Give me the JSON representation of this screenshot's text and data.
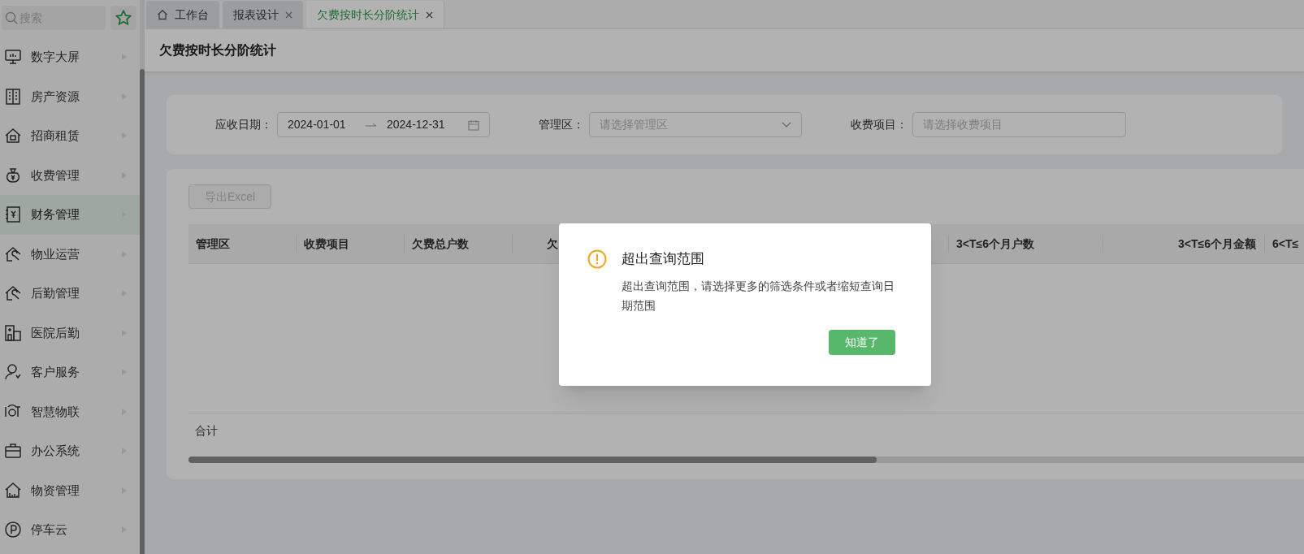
{
  "sidebar": {
    "search": {
      "placeholder": "搜索"
    },
    "items": [
      {
        "label": "数字大屏",
        "selected": false
      },
      {
        "label": "房产资源",
        "selected": false
      },
      {
        "label": "招商租赁",
        "selected": false
      },
      {
        "label": "收费管理",
        "selected": false
      },
      {
        "label": "财务管理",
        "selected": true
      },
      {
        "label": "物业运营",
        "selected": false
      },
      {
        "label": "后勤管理",
        "selected": false
      },
      {
        "label": "医院后勤",
        "selected": false
      },
      {
        "label": "客户服务",
        "selected": false
      },
      {
        "label": "智慧物联",
        "selected": false
      },
      {
        "label": "办公系统",
        "selected": false
      },
      {
        "label": "物资管理",
        "selected": false
      },
      {
        "label": "停车云",
        "selected": false
      }
    ]
  },
  "tabs": [
    {
      "label": "工作台",
      "selected": false,
      "closable": false
    },
    {
      "label": "报表设计",
      "selected": false,
      "closable": true
    },
    {
      "label": "欠费按时长分阶统计",
      "selected": true,
      "closable": true
    }
  ],
  "page_title": "欠费按时长分阶统计",
  "filters": [
    {
      "kind": "date_range",
      "label": "应收日期：",
      "start": "2024-01-01",
      "end": "2024-12-31"
    },
    {
      "kind": "select",
      "label": "管理区：",
      "placeholder": "请选择管理区"
    },
    {
      "kind": "input",
      "label": "收费项目：",
      "placeholder": "请选择收费项目"
    }
  ],
  "export_button": {
    "label": "导出Excel",
    "disabled": true
  },
  "table": {
    "columns": [
      {
        "label": "管理区"
      },
      {
        "label": "收费项目"
      },
      {
        "label": "欠费总户数"
      },
      {
        "label": "欠"
      },
      {
        "label": "3<T≤6个月户数"
      },
      {
        "label": "3<T≤6个月金额"
      },
      {
        "label": "6<T≤"
      }
    ],
    "footer_label": "合计"
  },
  "dialog": {
    "title": "超出查询范围",
    "message": "超出查询范围，请选择更多的筛选条件或者缩短查询日期范围",
    "button": "知道了"
  }
}
